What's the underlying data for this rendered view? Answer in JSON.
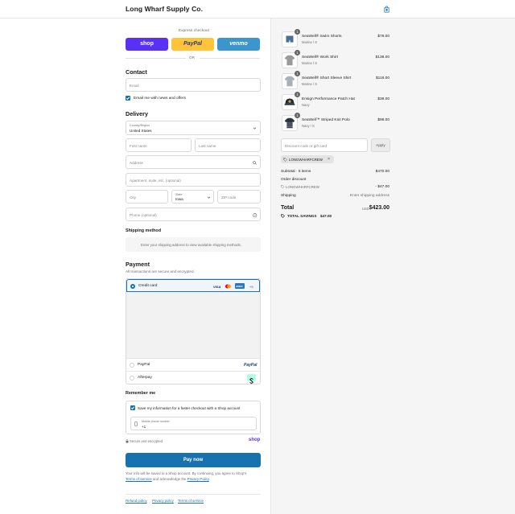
{
  "header": {
    "brand": "Long Wharf Supply Co.",
    "cart_icon": "shopping-bag-icon"
  },
  "express": {
    "title": "Express checkout",
    "shop_label": "shop",
    "paypal_label": "PayPal",
    "venmo_label": "venmo",
    "or_label": "OR",
    "colors": {
      "shop": "#5a31f4",
      "paypal": "#ffc439",
      "venmo": "#3d95ce"
    }
  },
  "contact": {
    "heading": "Contact",
    "email_placeholder": "Email",
    "news_label": "Email me with news and offers"
  },
  "delivery": {
    "heading": "Delivery",
    "country_label": "Country/Region",
    "country_value": "United States",
    "first_name": "First name",
    "last_name": "Last name",
    "address": "Address",
    "apartment": "Apartment, suite, etc. (optional)",
    "city": "City",
    "state_label": "State",
    "state_value": "Iowa",
    "zip": "ZIP code",
    "phone": "Phone (optional)"
  },
  "shipping": {
    "heading": "Shipping method",
    "message": "Enter your shipping address to view available shipping methods."
  },
  "payment": {
    "heading": "Payment",
    "subtitle": "All transactions are secure and encrypted.",
    "credit_card": "Credit card",
    "card_visa": "VISA",
    "card_amex": "AMEX",
    "card_more": "+5",
    "paypal": "PayPal",
    "paypal_logo": "PayPal",
    "afterpay": "Afterpay"
  },
  "remember": {
    "heading": "Remember me",
    "save_label": "Save my information for a faster checkout with a Shop account",
    "phone_label": "Mobile phone number",
    "phone_prefix": "+1",
    "secure": "Secure and encrypted",
    "shop_logo": "shop"
  },
  "pay": {
    "button": "Pay now",
    "legal_1": "Your info will be saved to a Shop account. By continuing, you agree to Shop's",
    "terms": "Terms of Service",
    "legal_and": "and acknowledge the",
    "privacy": "Privacy Policy",
    "legal_end": "."
  },
  "footer": {
    "refund": "Refund policy",
    "privacy": "Privacy policy",
    "tos": "Terms of service"
  },
  "cart": {
    "items": [
      {
        "name": "SeaWell® Swim Shorts",
        "variant": "Marine / S",
        "price": "$78.00",
        "qty": "1"
      },
      {
        "name": "SeaWell® Work Shirt",
        "variant": "Marine / S",
        "price": "$138.00",
        "qty": "1"
      },
      {
        "name": "SeaWell® Short Sleeve Shirt",
        "variant": "Marine / S",
        "price": "$118.00",
        "qty": "1"
      },
      {
        "name": "Ensign Performance Patch Hat",
        "variant": "Navy",
        "price": "$38.00",
        "qty": "1"
      },
      {
        "name": "SeaWell™ Striped Knit Polo",
        "variant": "Navy / S",
        "price": "$98.00",
        "qty": "1"
      }
    ],
    "discount_placeholder": "Discount code or gift card",
    "apply": "Apply",
    "applied_code": "LONGWHARFCREW",
    "subtotal_label": "Subtotal · 5 items",
    "subtotal_value": "$470.00",
    "order_discount_label": "Order discount",
    "discount_code": "LONGWHARFCREW",
    "discount_value": "- $47.00",
    "shipping_label": "Shipping",
    "shipping_value": "Enter shipping address",
    "total_label": "Total",
    "currency": "USD",
    "total_value": "$423.00",
    "savings_label": "TOTAL SAVINGS",
    "savings_value": "$47.00"
  }
}
